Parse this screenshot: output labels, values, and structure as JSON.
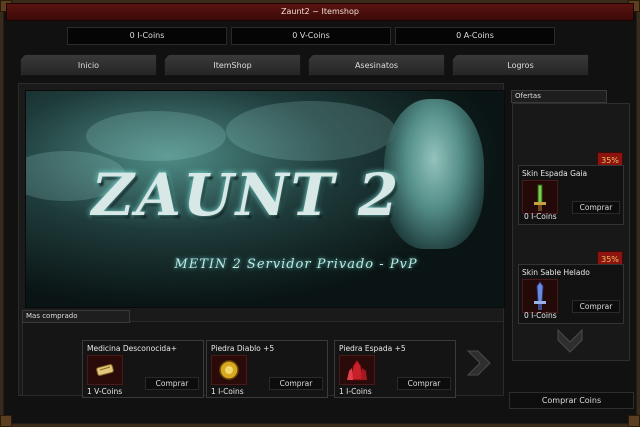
{
  "window": {
    "title": "Zaunt2 ~ Itemshop"
  },
  "balances": [
    {
      "label": "0 I-Coins"
    },
    {
      "label": "0 V-Coins"
    },
    {
      "label": "0 A-Coins"
    }
  ],
  "tabs": [
    {
      "label": "Inicio"
    },
    {
      "label": "ItemShop"
    },
    {
      "label": "Asesinatos"
    },
    {
      "label": "Logros"
    }
  ],
  "banner": {
    "title": "ZAUNT 2",
    "subtitle": "METIN 2  Servidor Privado - PvP"
  },
  "mas_comprado": {
    "label": "Mas comprado",
    "items": [
      {
        "name": "Medicina Desconocida+",
        "price": "1 V-Coins",
        "buy": "Comprar",
        "icon": "scroll-icon"
      },
      {
        "name": "Piedra Diablo +5",
        "price": "1 I-Coins",
        "buy": "Comprar",
        "icon": "gold-stone-icon"
      },
      {
        "name": "Piedra Espada +5",
        "price": "1 I-Coins",
        "buy": "Comprar",
        "icon": "red-crystal-icon"
      }
    ],
    "next_icon": "chevron-right-icon"
  },
  "ofertas": {
    "label": "Ofertas",
    "items": [
      {
        "name": "Skin Espada Gaia",
        "price": "0 I-Coins",
        "buy": "Comprar",
        "discount": "35%",
        "icon": "green-sword-icon"
      },
      {
        "name": "Skin Sable Helado",
        "price": "0 I-Coins",
        "buy": "Comprar",
        "discount": "35%",
        "icon": "ice-sword-icon"
      }
    ],
    "scroll_icon": "chevron-down-icon"
  },
  "comprar_coins": "Comprar Coins",
  "colors": {
    "titlebar": "#5c1410",
    "discount": "#8c1410",
    "accent_gold": "#f0c060"
  }
}
